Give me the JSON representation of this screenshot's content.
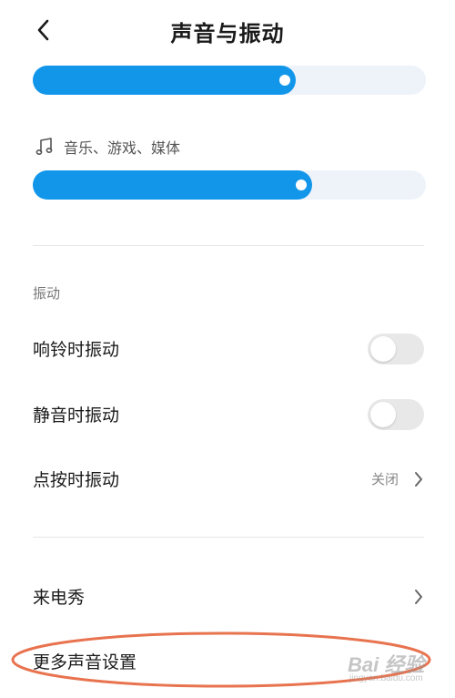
{
  "header": {
    "back_icon": "chevron-left-icon",
    "title": "声音与振动"
  },
  "volume": {
    "sliders": [
      {
        "name": "ringtone-volume",
        "level": 0.67
      },
      {
        "name": "media-volume",
        "level": 0.71
      }
    ],
    "media_label": "音乐、游戏、媒体",
    "media_icon": "music-note-icon"
  },
  "vibration": {
    "section_label": "振动",
    "ring_vibrate": {
      "label": "响铃时振动",
      "on": false
    },
    "silent_vibrate": {
      "label": "静音时振动",
      "on": false
    },
    "touch_vibrate": {
      "label": "点按时振动",
      "value": "关闭"
    }
  },
  "more": {
    "caller_show": {
      "label": "来电秀"
    },
    "more_sound_settings": {
      "label": "更多声音设置"
    }
  },
  "annotation": {
    "highlight_color": "#e8734f"
  },
  "watermark": {
    "brand": "Bai 经验",
    "url": "jingyan.baidu.com"
  },
  "colors": {
    "accent": "#1196ea",
    "slider_track": "#eef3fa",
    "toggle_off": "#e8e8e8"
  }
}
